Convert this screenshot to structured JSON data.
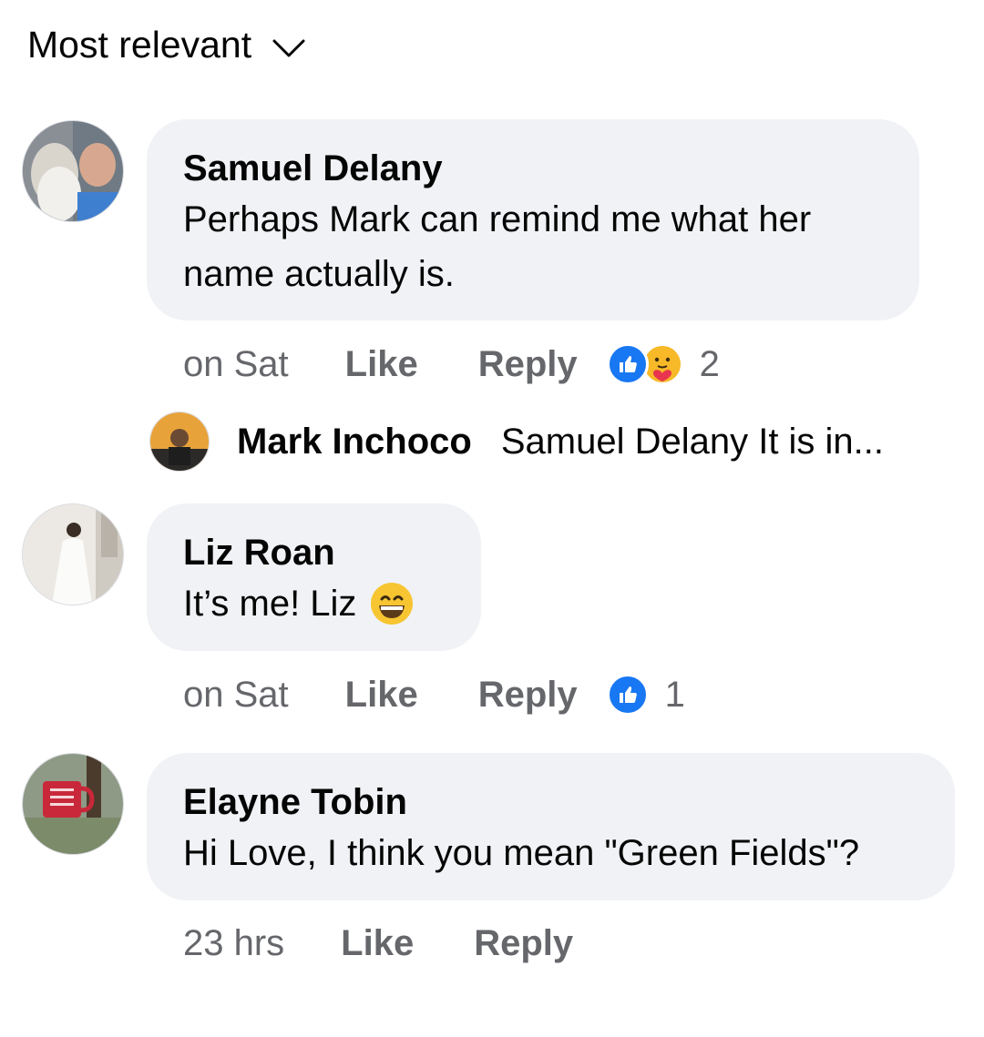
{
  "sort": {
    "label": "Most relevant",
    "icon": "chevron-down-icon"
  },
  "comments": [
    {
      "author": "Samuel Delany",
      "text_line1": "Perhaps Mark can remind me what her",
      "text_line2": "name actually is.",
      "time": "on Sat",
      "like_label": "Like",
      "reply_label": "Reply",
      "reactions": [
        "like-icon",
        "care-icon"
      ],
      "reaction_count": "2"
    },
    {
      "author": "Liz Roan",
      "text": "It’s me! Liz",
      "emoji": "grinning-face-icon",
      "time": "on Sat",
      "like_label": "Like",
      "reply_label": "Reply",
      "reactions": [
        "like-icon"
      ],
      "reaction_count": "1"
    },
    {
      "author": "Elayne Tobin",
      "text": "Hi Love, I think you mean \"Green Fields\"?",
      "time": "23 hrs",
      "like_label": "Like",
      "reply_label": "Reply"
    }
  ],
  "reply_preview": {
    "author": "Mark Inchoco",
    "snippet": "Samuel Delany It is in..."
  },
  "colors": {
    "bubble": "#f0f2f5",
    "meta_text": "#65676b",
    "like_blue": "#1877f2",
    "care_yellow": "#f7b928"
  }
}
